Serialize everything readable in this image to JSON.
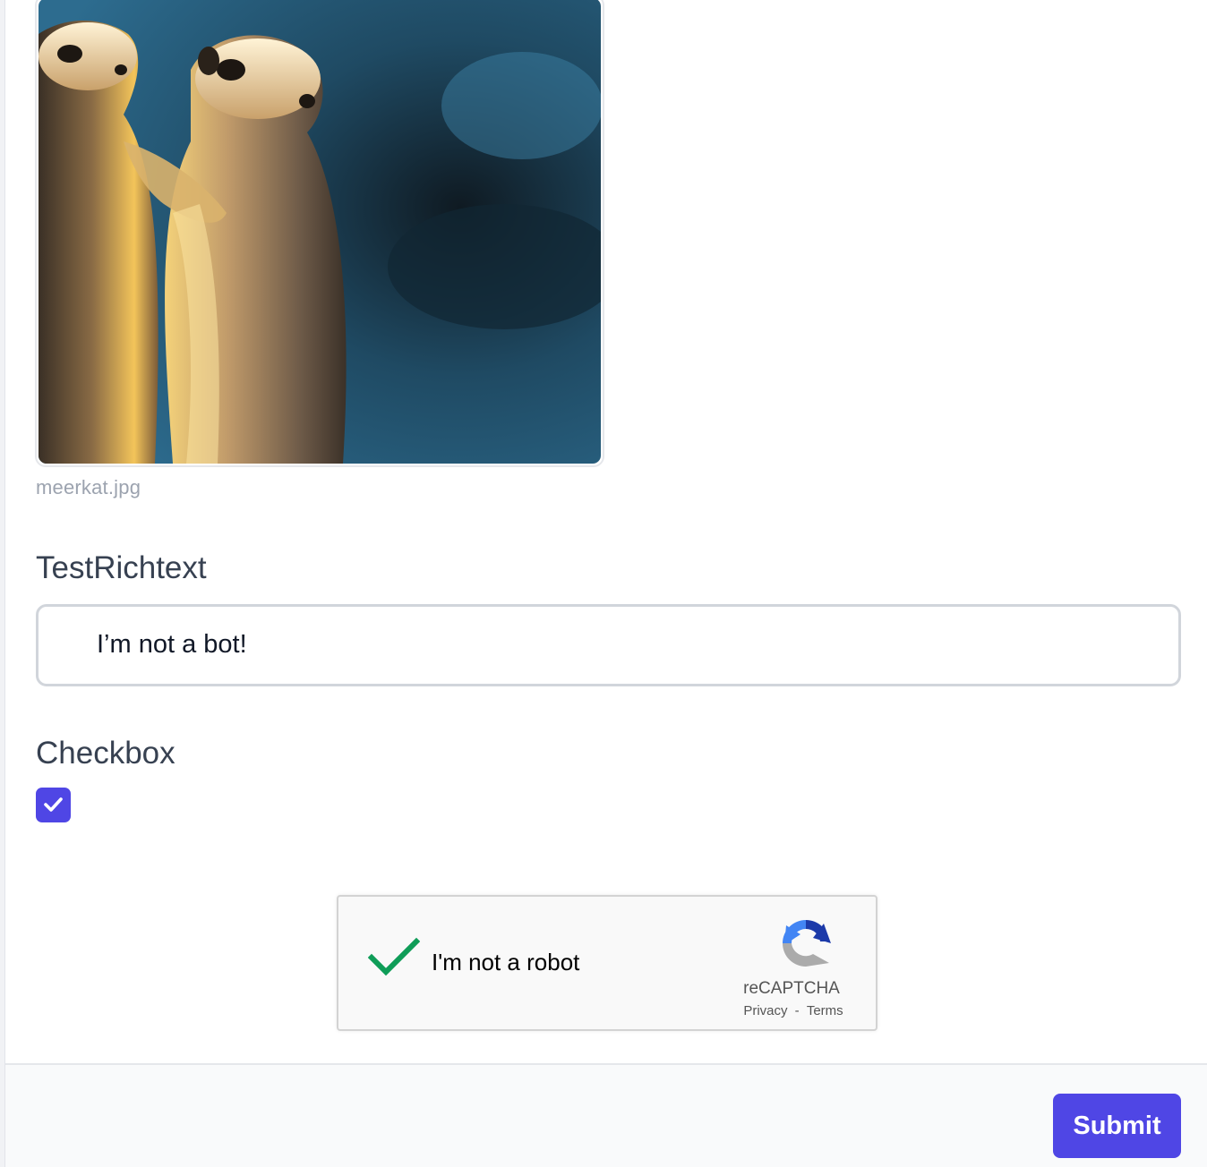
{
  "image_preview": {
    "file_name": "meerkat.jpg",
    "subject": "meerkat-photo"
  },
  "richtext_field": {
    "label": "TestRichtext",
    "value": "I’m not a bot!"
  },
  "checkbox_field": {
    "label": "Checkbox",
    "checked": true
  },
  "recaptcha": {
    "label": "I'm not a robot",
    "brand": "reCAPTCHA",
    "privacy_label": "Privacy",
    "separator": "-",
    "terms_label": "Terms",
    "verified": true
  },
  "footer": {
    "submit_label": "Submit"
  },
  "colors": {
    "accent": "#4f46e5",
    "label_text": "#374151",
    "muted_text": "#9ca3af",
    "check_green": "#0f9d58"
  }
}
